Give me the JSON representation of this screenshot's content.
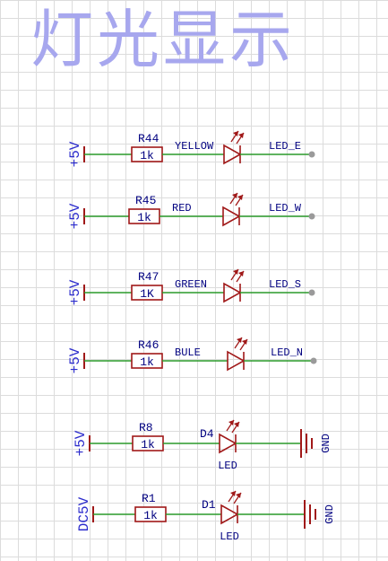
{
  "title": "灯光显示",
  "colors": {
    "wire": "#2a9a2a",
    "component": "#a01818",
    "power_label": "#2c2ccc",
    "ref_text": "#000080",
    "terminal": "#9a9a9a",
    "title": "#a7a7ee"
  },
  "circuits": [
    {
      "power": "+5V",
      "resistor": "R44",
      "resistor_value": "1k",
      "net_left": "YELLOW",
      "led_ref": "",
      "led_value": "",
      "end": "terminal",
      "end_label": "LED_E"
    },
    {
      "power": "+5V",
      "resistor": "R45",
      "resistor_value": "1k",
      "net_left": "RED",
      "led_ref": "",
      "led_value": "",
      "end": "terminal",
      "end_label": "LED_W"
    },
    {
      "power": "+5V",
      "resistor": "R47",
      "resistor_value": "1K",
      "net_left": "GREEN",
      "led_ref": "",
      "led_value": "",
      "end": "terminal",
      "end_label": "LED_S"
    },
    {
      "power": "+5V",
      "resistor": "R46",
      "resistor_value": "1k",
      "net_left": "BULE",
      "led_ref": "",
      "led_value": "",
      "end": "terminal",
      "end_label": "LED_N"
    },
    {
      "power": "+5V",
      "resistor": "R8",
      "resistor_value": "1k",
      "net_left": "",
      "led_ref": "D4",
      "led_value": "LED",
      "end": "ground",
      "end_label": "GND"
    },
    {
      "power": "DC5V",
      "resistor": "R1",
      "resistor_value": "1k",
      "net_left": "",
      "led_ref": "D1",
      "led_value": "LED",
      "end": "ground",
      "end_label": "GND"
    }
  ]
}
